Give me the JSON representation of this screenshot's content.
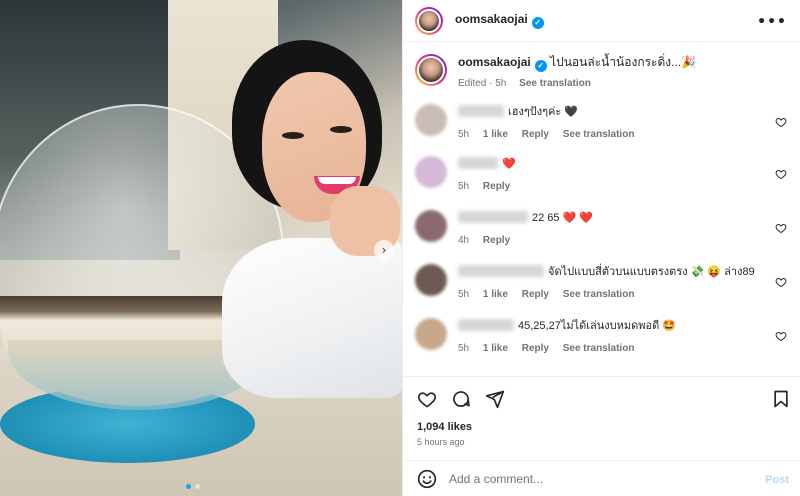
{
  "header": {
    "username": "oomsakaojai",
    "more_label": "•••"
  },
  "caption": {
    "username": "oomsakaojai",
    "text": "ไปนอนล่ะน้ำน้องกระดิ่ง...🎉",
    "edited": "Edited · 5h",
    "see_translation": "See translation"
  },
  "comments": [
    {
      "text": "เฮงๆปังๆค่ะ 🖤",
      "time": "5h",
      "likes": "1 like",
      "reply": "Reply",
      "see_translation": "See translation",
      "avatar_color": "#c9bdb5"
    },
    {
      "text": "❤️",
      "time": "5h",
      "likes": "",
      "reply": "Reply",
      "see_translation": "",
      "avatar_color": "#d6b8d8"
    },
    {
      "text": "22 65 ❤️ ❤️",
      "time": "4h",
      "likes": "",
      "reply": "Reply",
      "see_translation": "",
      "avatar_color": "#8a6a6e"
    },
    {
      "text": "จัดไปแบบสี่ตัวบนแบบตรงตรง 💸 😝 ล่าง89",
      "time": "5h",
      "likes": "1 like",
      "reply": "Reply",
      "see_translation": "See translation",
      "avatar_color": "#6e5a52"
    },
    {
      "text": "45,25,27ไม่ได้เล่นงบหมดพอดี 🤩",
      "time": "5h",
      "likes": "1 like",
      "reply": "Reply",
      "see_translation": "See translation",
      "avatar_color": "#c7a88a"
    }
  ],
  "actions": {
    "likes": "1,094 likes",
    "time": "5 hours ago"
  },
  "add_comment": {
    "placeholder": "Add a comment...",
    "post_label": "Post"
  },
  "carousel": {
    "next_icon": "chevron-right-icon"
  },
  "colors": {
    "verified_blue": "#0095f6",
    "like_red": "#ed4956",
    "post_disabled": "#b3dbff"
  }
}
